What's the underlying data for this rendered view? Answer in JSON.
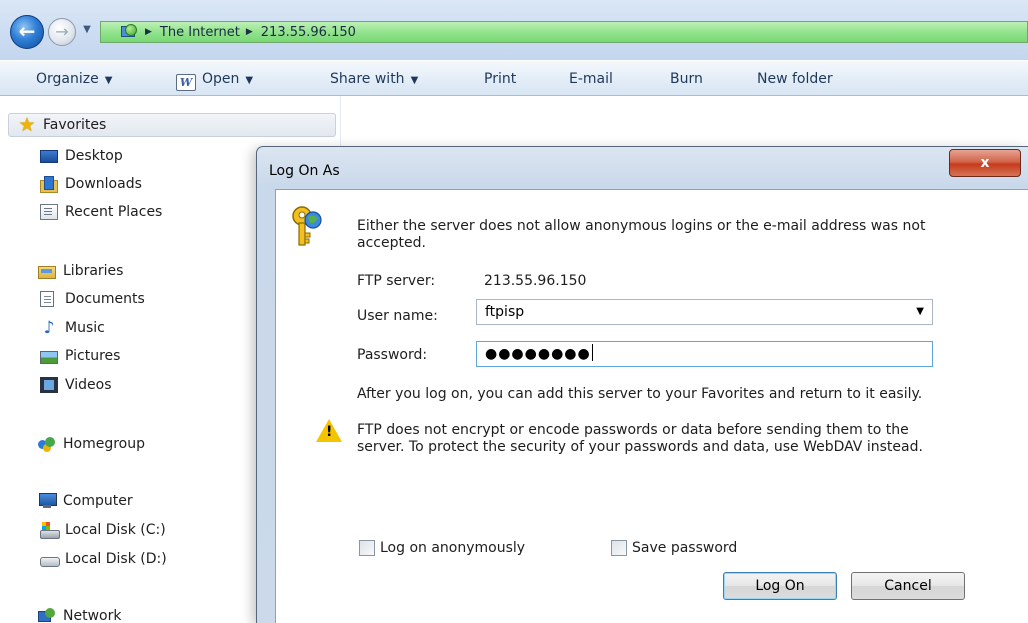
{
  "address_bar": {
    "crumbs": [
      "The Internet",
      "213.55.96.150"
    ],
    "icons": [
      "back-arrow-icon",
      "forward-arrow-icon",
      "network-globe-icon"
    ]
  },
  "commandbar": {
    "organize": "Organize",
    "open": "Open",
    "share_with": "Share with",
    "print": "Print",
    "email": "E-mail",
    "burn": "Burn",
    "new_folder": "New folder"
  },
  "sidebar": {
    "favorites": "Favorites",
    "desktop": "Desktop",
    "downloads": "Downloads",
    "recent_places": "Recent Places",
    "libraries": "Libraries",
    "documents": "Documents",
    "music": "Music",
    "pictures": "Pictures",
    "videos": "Videos",
    "homegroup": "Homegroup",
    "computer": "Computer",
    "local_disk_c": "Local Disk (C:)",
    "local_disk_d": "Local Disk (D:)",
    "network": "Network"
  },
  "dialog": {
    "title": "Log On As",
    "close_label": "x",
    "message_line1": "Either the server does not allow anonymous logins or the e-mail address was not",
    "message_line2": "accepted.",
    "ftp_server_label": "FTP server:",
    "ftp_server_value": "213.55.96.150",
    "user_name_label": "User name:",
    "user_name_value": "ftpisp",
    "password_label": "Password:",
    "password_masked": "●●●●●●●●",
    "favorites_note": "After you log on, you can add this server to your Favorites and return to it easily.",
    "warning_line1": "FTP does not encrypt or encode passwords or data before sending them to the",
    "warning_line2": "server.  To protect the security of your passwords and data, use WebDAV instead.",
    "log_on_anonymously_label": "Log on anonymously",
    "log_on_anonymously_checked": false,
    "save_password_label": "Save password",
    "save_password_checked": false,
    "log_on_button": "Log On",
    "cancel_button": "Cancel"
  },
  "colors": {
    "address_green": "#8fe28a",
    "dialog_frame": "#c9d8ea",
    "close_red": "#c43c1c",
    "warning_yellow": "#f5c400"
  }
}
